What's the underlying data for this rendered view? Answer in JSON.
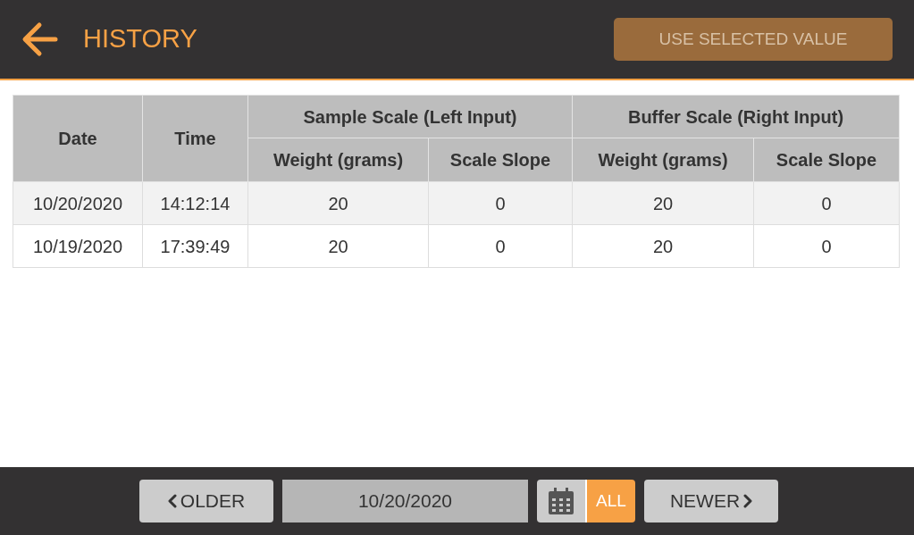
{
  "header": {
    "title": "HISTORY",
    "action": {
      "label": "USE SELECTED VALUE",
      "disabled": true
    }
  },
  "table": {
    "columns": [
      {
        "label": "Date"
      },
      {
        "label": "Time"
      }
    ],
    "groups": [
      {
        "label": "Sample Scale (Left Input)",
        "columns": [
          "Weight (grams)",
          "Scale Slope"
        ]
      },
      {
        "label": "Buffer Scale (Right Input)",
        "columns": [
          "Weight (grams)",
          "Scale Slope"
        ]
      }
    ],
    "rows": [
      [
        "10/20/2020",
        "14:12:14",
        "20",
        "0",
        "20",
        "0"
      ],
      [
        "10/19/2020",
        "17:39:49",
        "20",
        "0",
        "20",
        "0"
      ]
    ]
  },
  "footer": {
    "older": "OLDER",
    "date": "10/20/2020",
    "all": {
      "label": "ALL",
      "on": true
    },
    "newer": "NEWER"
  }
}
